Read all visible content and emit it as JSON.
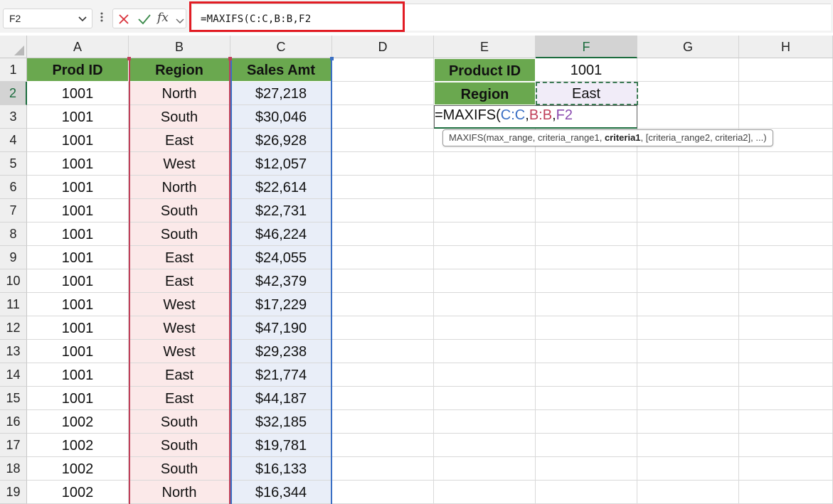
{
  "formula_bar": {
    "name_box": "F2",
    "fx_label": "fx",
    "formula": "=MAXIFS(C:C,B:B,F2"
  },
  "columns": [
    "A",
    "B",
    "C",
    "D",
    "E",
    "F",
    "G",
    "H"
  ],
  "rows": [
    "1",
    "2",
    "3",
    "4",
    "5",
    "6",
    "7",
    "8",
    "9",
    "10",
    "11",
    "12",
    "13",
    "14",
    "15",
    "16",
    "17",
    "18",
    "19"
  ],
  "table": {
    "headers": [
      "Prod ID",
      "Region",
      "Sales Amt"
    ],
    "data": [
      [
        "1001",
        "North",
        "$27,218"
      ],
      [
        "1001",
        "South",
        "$30,046"
      ],
      [
        "1001",
        "East",
        "$26,928"
      ],
      [
        "1001",
        "West",
        "$12,057"
      ],
      [
        "1001",
        "North",
        "$22,614"
      ],
      [
        "1001",
        "South",
        "$22,731"
      ],
      [
        "1001",
        "South",
        "$46,224"
      ],
      [
        "1001",
        "East",
        "$24,055"
      ],
      [
        "1001",
        "East",
        "$42,379"
      ],
      [
        "1001",
        "West",
        "$17,229"
      ],
      [
        "1001",
        "West",
        "$47,190"
      ],
      [
        "1001",
        "West",
        "$29,238"
      ],
      [
        "1001",
        "East",
        "$21,774"
      ],
      [
        "1001",
        "East",
        "$44,187"
      ],
      [
        "1002",
        "South",
        "$32,185"
      ],
      [
        "1002",
        "South",
        "$19,781"
      ],
      [
        "1002",
        "South",
        "$16,133"
      ],
      [
        "1002",
        "North",
        "$16,344"
      ]
    ]
  },
  "criteria": {
    "product_label": "Product ID",
    "product_value": "1001",
    "region_label": "Region",
    "region_value": "East"
  },
  "edit": {
    "prefix": "=MAXIFS(",
    "arg1": "C:C",
    "sep1": ",",
    "arg2": "B:B",
    "sep2": ",",
    "arg3": "F2"
  },
  "tooltip": {
    "pre": "MAXIFS(max_range, criteria_range1, ",
    "bold": "criteria1",
    "post": ", [criteria_range2, criteria2], ...)"
  },
  "colors": {
    "header_green": "#6aa84f",
    "criteria_range_pink": "#fbe9e9",
    "max_range_blue": "#e9eef8",
    "ref_blue": "#3a6fc4",
    "ref_red": "#c0405a",
    "ref_purple": "#8a4bb0",
    "highlight_red": "#e21c24"
  }
}
